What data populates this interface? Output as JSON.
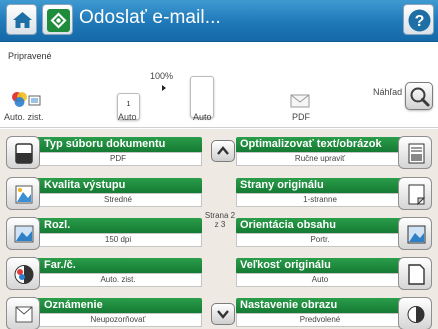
{
  "header": {
    "title": "Odoslať e-mail...",
    "home_icon": "home-icon",
    "app_icon": "email-app-icon",
    "help_icon": "help-icon",
    "help_glyph": "?"
  },
  "status": "Pripravené",
  "preview": {
    "zoom": "100%",
    "auto_zist": "Auto. zist.",
    "label_auto1": "Auto",
    "label_auto2": "Auto",
    "label_pdf": "PDF",
    "preview_label": "Náhľad",
    "copies": "1"
  },
  "page_indicator": {
    "line1": "Strana 2",
    "line2": "z 3"
  },
  "options_left": [
    {
      "label": "Typ súboru dokumentu",
      "value": "PDF",
      "icon": "document-file-icon"
    },
    {
      "label": "Kvalita výstupu",
      "value": "Stredné",
      "icon": "output-quality-icon"
    },
    {
      "label": "Rozl.",
      "value": "150 dpi",
      "icon": "resolution-icon"
    },
    {
      "label": "Far./č.",
      "value": "Auto. zist.",
      "icon": "color-icon"
    },
    {
      "label": "Oznámenie",
      "value": "Neupozorňovať",
      "icon": "notification-icon"
    }
  ],
  "options_right": [
    {
      "label": "Optimalizovať text/obrázok",
      "value": "Ručne upraviť",
      "icon": "optimize-text-image-icon"
    },
    {
      "label": "Strany originálu",
      "value": "1-stranne",
      "icon": "original-sides-icon"
    },
    {
      "label": "Orientácia obsahu",
      "value": "Portr.",
      "icon": "content-orientation-icon"
    },
    {
      "label": "Veľkosť originálu",
      "value": "Auto",
      "icon": "original-size-icon"
    },
    {
      "label": "Nastavenie obrazu",
      "value": "Predvolené",
      "icon": "image-adjust-icon"
    }
  ],
  "colors": {
    "title_bar": "#1f78b8",
    "option_header": "#1e8c3f",
    "settings_bg": "#efe9e4"
  }
}
